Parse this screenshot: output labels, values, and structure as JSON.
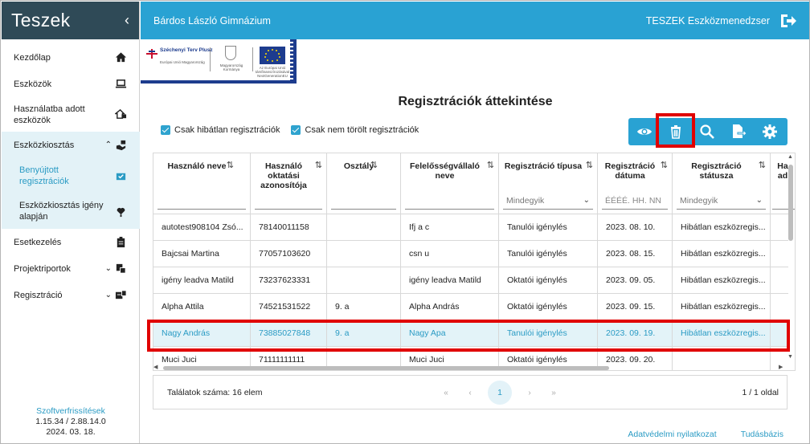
{
  "sidebar": {
    "brand": "Teszek",
    "items": [
      {
        "label": "Kezdőlap",
        "icon": "home-icon"
      },
      {
        "label": "Eszközök",
        "icon": "laptop-icon"
      },
      {
        "label": "Használatba adott eszközök",
        "icon": "device-handover-icon"
      },
      {
        "label": "Eszközkiosztás",
        "icon": "hand-device-icon"
      },
      {
        "label": "Benyújtott regisztrációk",
        "icon": "inbox-check-icon"
      },
      {
        "label": "Eszközkiosztás igény alapján",
        "icon": "hand-heart-icon"
      },
      {
        "label": "Esetkezelés",
        "icon": "clipboard-icon"
      },
      {
        "label": "Projektriportok",
        "icon": "report-icon"
      },
      {
        "label": "Regisztráció",
        "icon": "registration-icon"
      }
    ],
    "footer": {
      "link": "Szoftverfrissítések",
      "version": "1.15.34 / 2.88.14.0",
      "date": "2024. 03. 18."
    }
  },
  "topbar": {
    "title": "Bárdos László Gimnázium",
    "app_name": "TESZEK Eszközmenedzser"
  },
  "logos": {
    "szechenyi": "Széchenyi Terv Plusz",
    "szechenyi_sub": "Európai Unió Magyarország",
    "ministry": "Magyarország Kormánya",
    "eu": "Az Európai Unió társfinanszírozásával NextGenerationEU"
  },
  "main": {
    "title": "Regisztrációk áttekintése",
    "filters": [
      {
        "label": "Csak hibátlan regisztrációk",
        "checked": true
      },
      {
        "label": "Csak nem törölt regisztrációk",
        "checked": true
      }
    ],
    "toolbar": [
      "view-icon",
      "delete-icon",
      "search-icon",
      "export-icon",
      "settings-icon"
    ]
  },
  "table": {
    "columns": [
      {
        "label": "Használó neve",
        "sort": "⇅",
        "filter": ""
      },
      {
        "label": "Használó oktatási azonosítója",
        "sort": "⇅",
        "filter": ""
      },
      {
        "label": "Osztály",
        "sort": "⇅",
        "filter": ""
      },
      {
        "label": "Felelősségvállaló neve",
        "sort": "⇅",
        "filter": ""
      },
      {
        "label": "Regisztráció típusa",
        "sort": "⇅",
        "filter": "Mindegyik"
      },
      {
        "label": "Regisztráció dátuma",
        "sort": "⇅",
        "filter": "ÉÉÉÉ. HH. NN"
      },
      {
        "label": "Regisztráció státusza",
        "sort": "⇅",
        "filter": "Mindegyik"
      },
      {
        "label": "Ha ad",
        "sort": "",
        "filter": ""
      }
    ],
    "rows": [
      [
        "autotest908104 Zsó...",
        "78140011158",
        "",
        "Ifj a c",
        "Tanulói igénylés",
        "2023. 08. 10.",
        "Hibátlan eszközregis...",
        ""
      ],
      [
        "Bajcsai Martina",
        "77057103620",
        "",
        "csn u",
        "Tanulói igénylés",
        "2023. 08. 15.",
        "Hibátlan eszközregis...",
        ""
      ],
      [
        "igény leadva Matild",
        "73237623331",
        "",
        "igény leadva Matild",
        "Oktatói igénylés",
        "2023. 09. 05.",
        "Hibátlan eszközregis...",
        ""
      ],
      [
        "Alpha Attila",
        "74521531522",
        "9. a",
        "Alpha András",
        "Oktatói igénylés",
        "2023. 09. 15.",
        "Hibátlan eszközregis...",
        ""
      ],
      [
        "Nagy András",
        "73885027848",
        "9. a",
        "Nagy Apa",
        "Tanulói igénylés",
        "2023. 09. 19.",
        "Hibátlan eszközregis...",
        ""
      ],
      [
        "Muci Juci",
        "71111111111",
        "",
        "Muci Juci",
        "Oktatói igénylés",
        "2023. 09. 20.",
        "",
        ""
      ]
    ],
    "selected_row": 4
  },
  "pager": {
    "count_label": "Találatok száma: 16 elem",
    "first": "«",
    "prev": "‹",
    "current": "1",
    "next": "›",
    "last": "»",
    "page_info": "1 / 1 oldal"
  },
  "footer": {
    "privacy": "Adatvédelmi nyilatkozat",
    "kb": "Tudásbázis"
  },
  "colors": {
    "sidebar_header": "#2f4a57",
    "accent": "#29a2d3",
    "selection": "#e3f3f8",
    "highlight": "#e00000"
  }
}
